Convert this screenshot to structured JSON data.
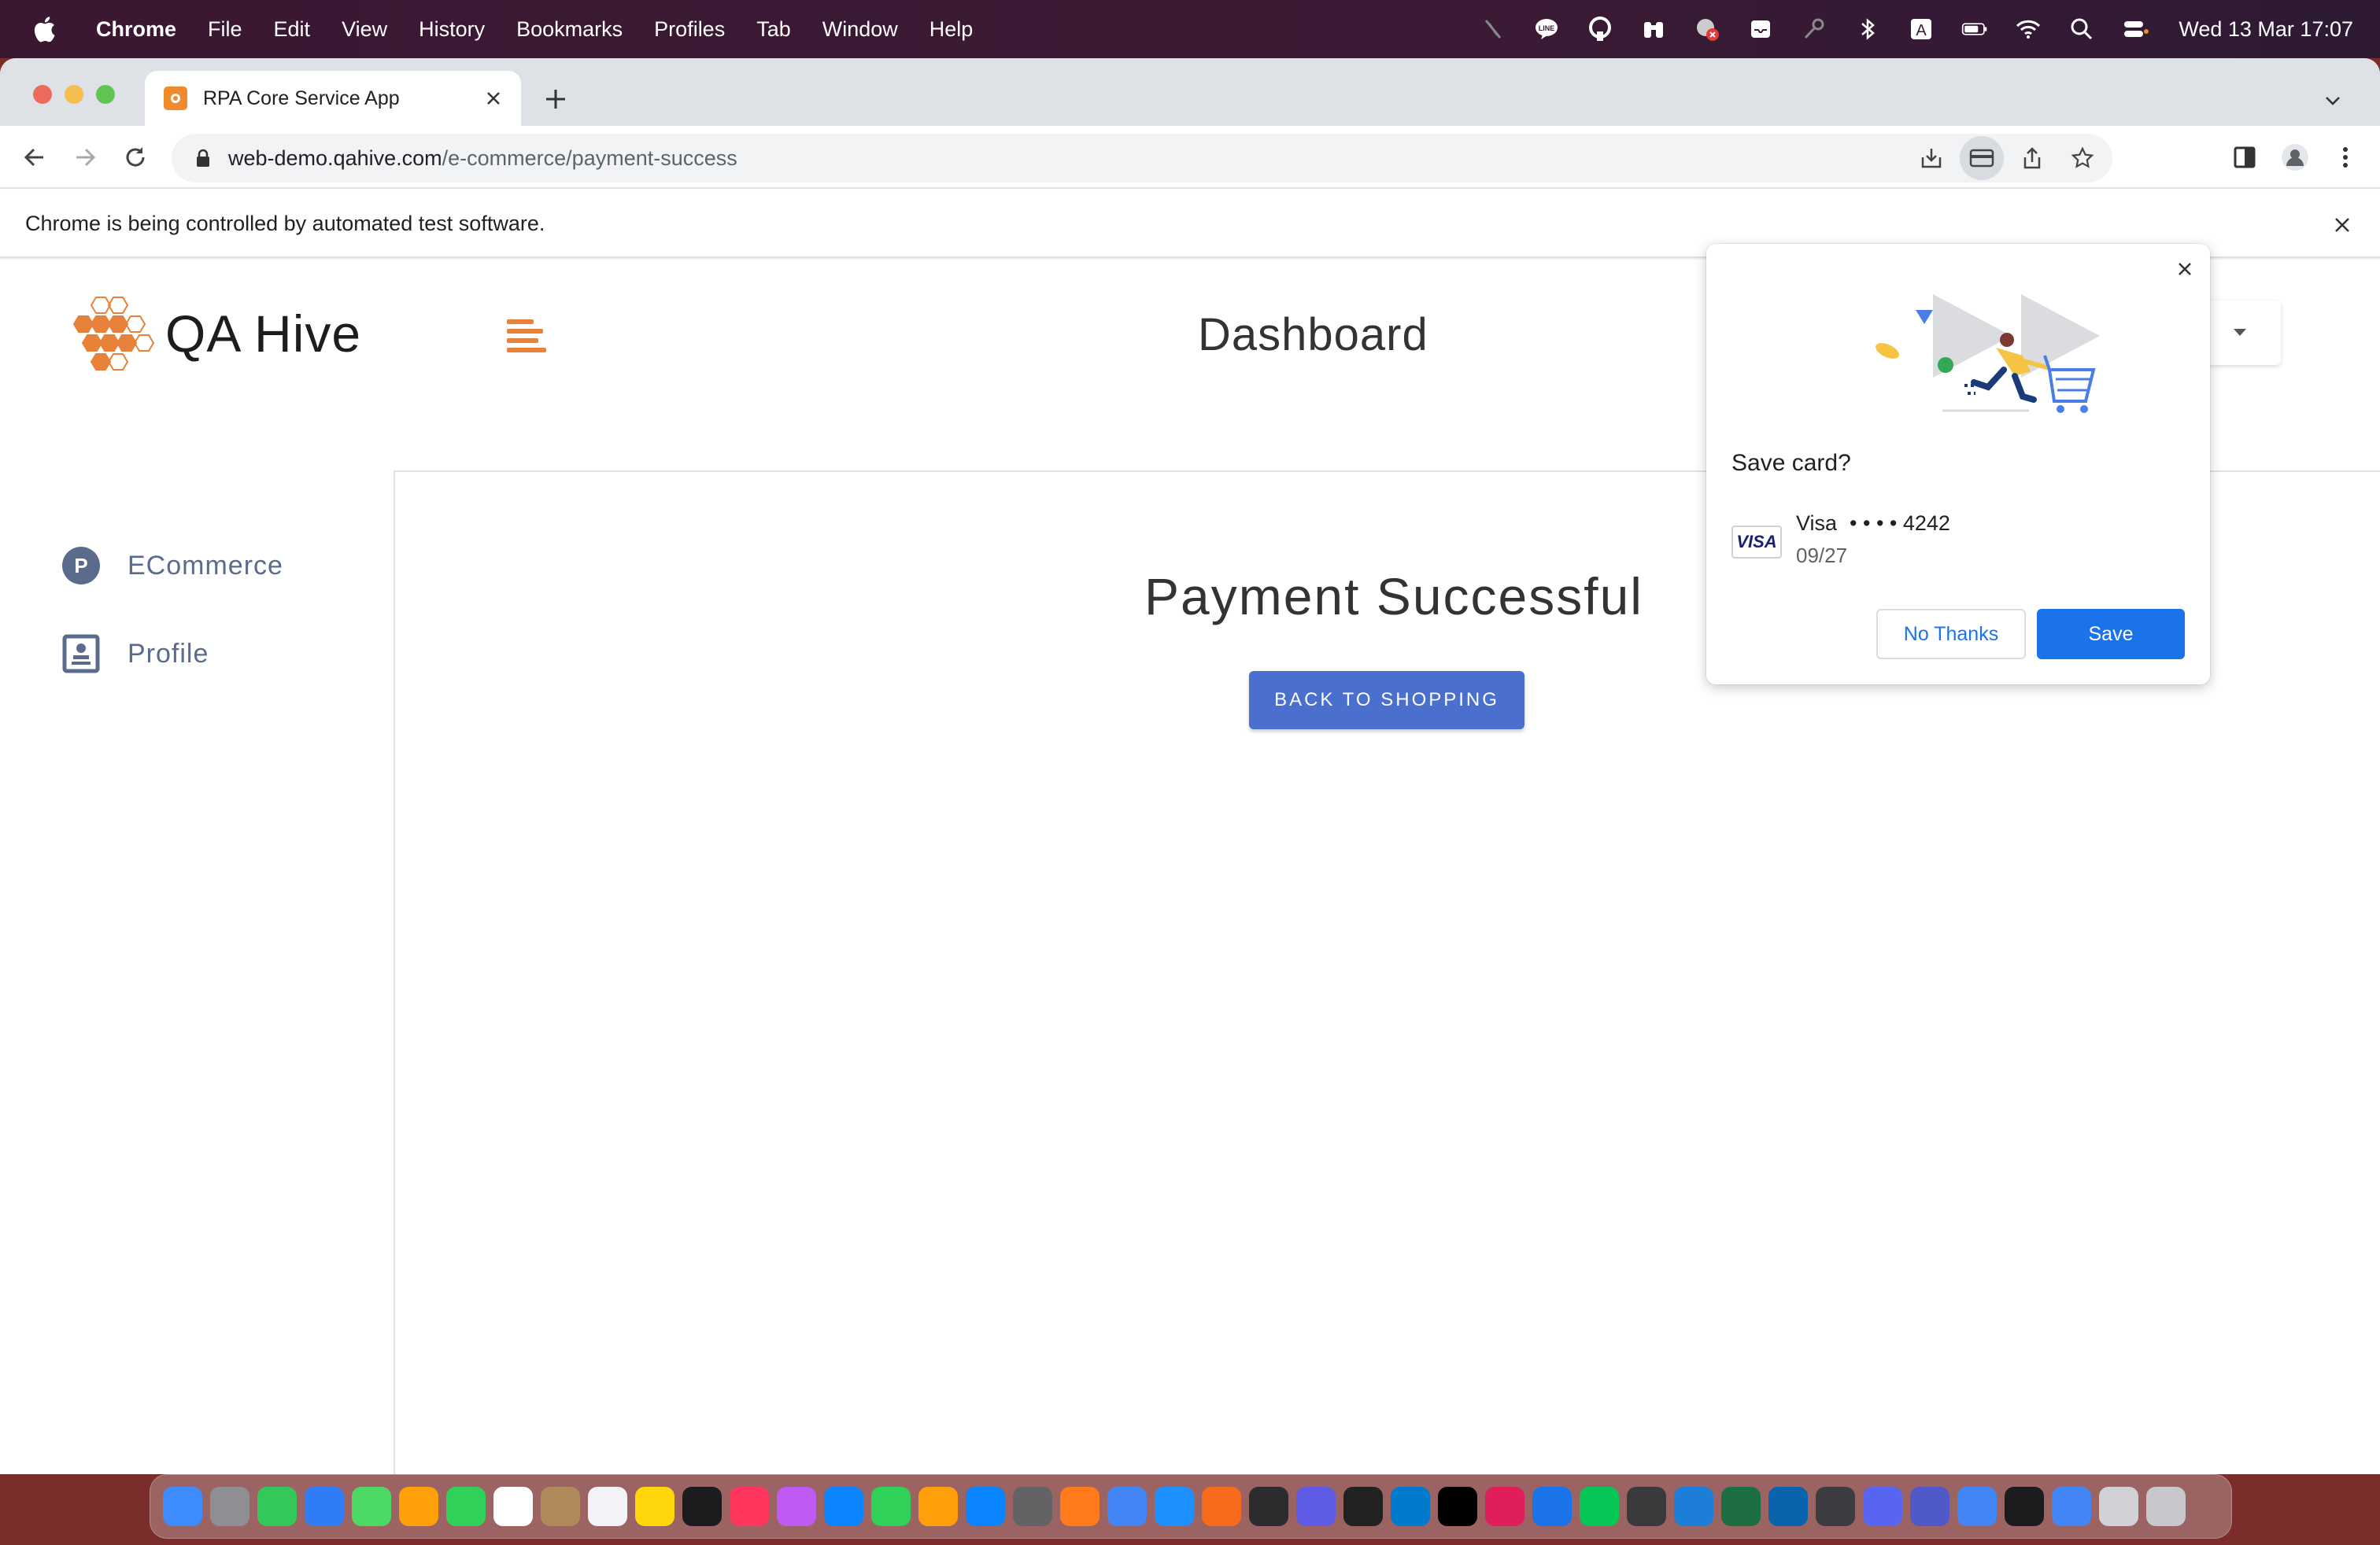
{
  "menubar": {
    "app_name": "Chrome",
    "items": [
      "File",
      "Edit",
      "View",
      "History",
      "Bookmarks",
      "Profiles",
      "Tab",
      "Window",
      "Help"
    ],
    "clock": "Wed 13 Mar  17:07"
  },
  "browser": {
    "tab_title": "RPA Core Service App",
    "url_host": "web-demo.qahive.com",
    "url_path": "/e-commerce/payment-success",
    "infobar_text": "Chrome is being controlled by automated test software."
  },
  "app": {
    "logo_text": "QA Hive",
    "page_title": "Dashboard",
    "sidebar": [
      {
        "label": "ECommerce",
        "icon": "p-circle-icon"
      },
      {
        "label": "Profile",
        "icon": "profile-card-icon"
      }
    ],
    "main": {
      "heading": "Payment Successful",
      "back_button": "BACK TO SHOPPING"
    }
  },
  "save_card": {
    "heading": "Save card?",
    "card_brand_logo": "VISA",
    "card_name": "Visa",
    "card_number": "• • • • 4242",
    "expiry": "09/27",
    "no_thanks": "No Thanks",
    "save": "Save"
  },
  "colors": {
    "brand_orange": "#e8823a",
    "primary_button": "#4a6fce",
    "chrome_blue": "#1a73e8"
  },
  "dock": {
    "apps": [
      "finder",
      "launchpad",
      "messages",
      "mail",
      "maps",
      "photos",
      "facetime",
      "calendar",
      "contacts",
      "reminders",
      "notes",
      "apple-tv",
      "music",
      "podcasts",
      "keynote",
      "numbers",
      "pages",
      "app-store",
      "system-settings",
      "firefox",
      "chrome",
      "safari",
      "sketch",
      "vpn",
      "prism",
      "preview",
      "vscode",
      "intellij",
      "slack",
      "location",
      "line",
      "quicktime",
      "xcode",
      "excel",
      "outlook",
      "ubuntu",
      "discord",
      "teams",
      "chrome-x",
      "terminal",
      "chrome-2",
      "downloads",
      "trash"
    ]
  }
}
